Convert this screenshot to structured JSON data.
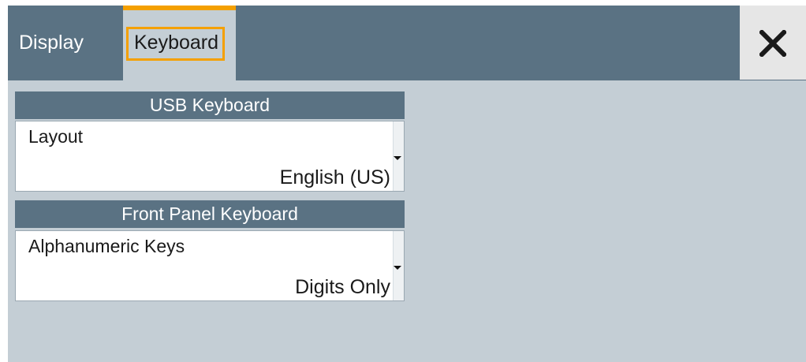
{
  "tabs": [
    {
      "label": "Display",
      "selected": false
    },
    {
      "label": "Keyboard",
      "selected": true
    }
  ],
  "close_button": {
    "icon": "close-icon"
  },
  "usb_keyboard": {
    "header": "USB Keyboard",
    "layout": {
      "label": "Layout",
      "value": "English (US)"
    }
  },
  "front_panel_keyboard": {
    "header": "Front Panel Keyboard",
    "alphanumeric_keys": {
      "label": "Alphanumeric Keys",
      "value": "Digits Only"
    }
  },
  "colors": {
    "tabbar": "#5a7283",
    "content_bg": "#c4ced5",
    "accent": "#f4a000",
    "section_header": "#5a7283"
  }
}
